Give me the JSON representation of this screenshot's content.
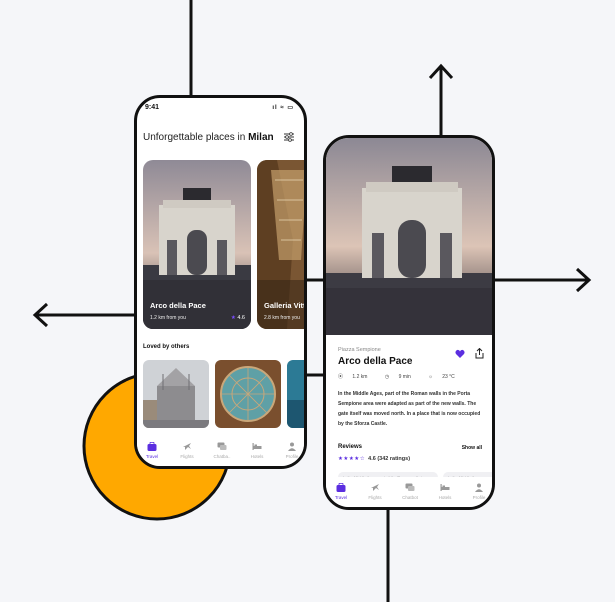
{
  "colors": {
    "accent": "#5b2ee0",
    "circle": "#ffa800",
    "line": "#111111"
  },
  "left_phone": {
    "time": "9:41",
    "status_icons": "ıl ≈ ▭",
    "title_prefix": "Unforgettable places in",
    "title_city": "Milan",
    "cards": [
      {
        "name": "Arco della Pace",
        "distance": "1.2 km from you",
        "rating": "4.6"
      },
      {
        "name": "Galleria Vitt",
        "distance": "2.8 km from you"
      }
    ],
    "loved_title": "Loved by others",
    "tabs": [
      "Travel",
      "Flights",
      "Chatba..",
      "Hotels",
      "Profile"
    ]
  },
  "right_phone": {
    "subtitle": "Piazza Sempione",
    "title": "Arco della Pace",
    "distance": "1.2 km",
    "walk": "9 min",
    "temp": "23 °C",
    "description": "In the Middle Ages, part of the Roman walls in the Porta Sempione area were adapted as part of the new walls. The gate itself was moved north. In a place that is now occupied by the Sforza Castle.",
    "reviews_label": "Reviews",
    "show_all": "Show all",
    "rating_text": "4.6 (342 ratings)",
    "snippets": [
      "In the Middle Ages, part of the Roman walls in",
      "In the Middle Ages..."
    ],
    "tabs": [
      "Travel",
      "Flights",
      "Chatbot",
      "Hotels",
      "Profile"
    ]
  }
}
